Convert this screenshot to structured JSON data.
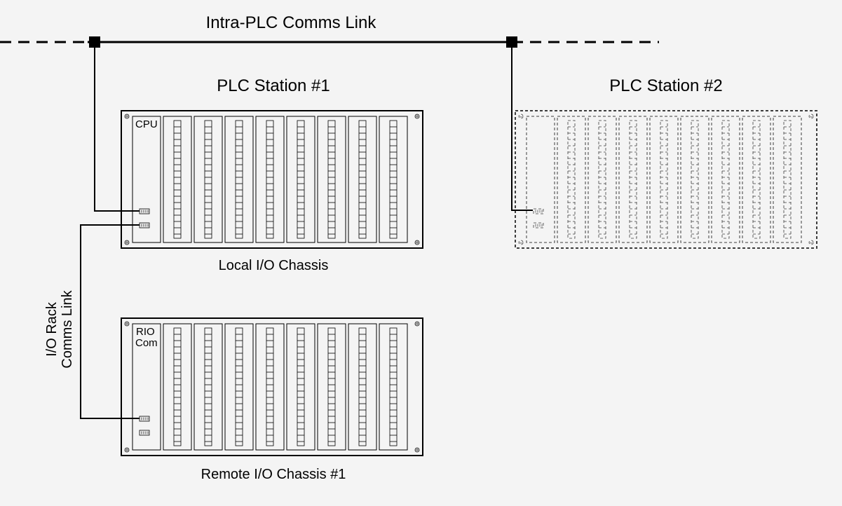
{
  "bus_label": "Intra-PLC Comms Link",
  "station1_title": "PLC Station #1",
  "station2_title": "PLC Station #2",
  "local_caption": "Local I/O Chassis",
  "remote_caption": "Remote I/O Chassis #1",
  "side_label_line1": "I/O Rack",
  "side_label_line2": "Comms Link",
  "cpu_label": "CPU",
  "rio_label_line1": "RIO",
  "rio_label_line2": "Com"
}
